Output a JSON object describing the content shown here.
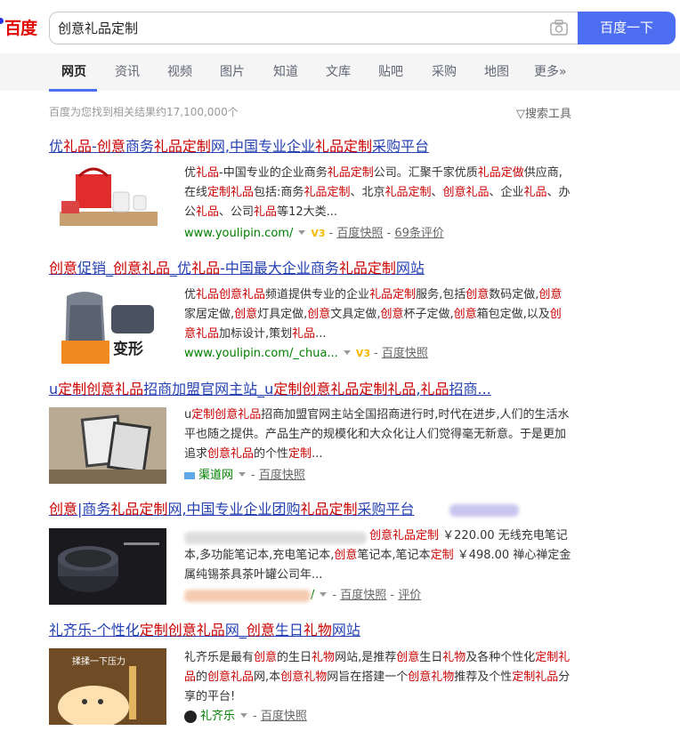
{
  "header": {
    "logo_text": "百度",
    "query": "创意礼品定制",
    "search_button": "百度一下",
    "brand_color": "#4e6ef2"
  },
  "tabs": [
    "网页",
    "资讯",
    "视频",
    "图片",
    "知道",
    "文库",
    "贴吧",
    "采购",
    "地图",
    "更多»"
  ],
  "active_tab": "网页",
  "stats": "百度为您找到相关结果约17,100,000个",
  "tools": "搜索工具",
  "results": [
    {
      "title": "优礼品-创意商务礼品定制网,中国专业企业礼品定制采购平台",
      "abstract": "优礼品-中国专业的企业商务礼品定制公司。汇聚千家优质礼品定做供应商,在线定制礼品包括:商务礼品定制、北京礼品定制、创意礼品、企业礼品、办公礼品、公司礼品等12大类...",
      "url": "www.youlipin.com/",
      "badge": "V3",
      "snapshot": "百度快照",
      "reviews": "69条评价"
    },
    {
      "title": "创意促销_创意礼品_优礼品-中国最大企业商务礼品定制网站",
      "abstract": "优礼品创意礼品频道提供专业的企业礼品定制服务,包括创意数码定做,创意家居定做,创意灯具定做,创意文具定做,创意杯子定做,创意箱包定做,以及创意礼品加标设计,策划礼品...",
      "url": "www.youlipin.com/_chua...",
      "badge": "V3",
      "snapshot": "百度快照",
      "thumb_text": "变形"
    },
    {
      "title": "u定制创意礼品招商加盟官网主站_u定制创意礼品定制礼品,礼品招商...",
      "abstract": "u定制创意礼品招商加盟官网主站全国招商进行时,时代在进步,人们的生活水平也随之提供。产品生产的规模化和大众化让人们觉得毫无新意。于是更加追求创意礼品的个性定制...",
      "url": "渠道网",
      "snapshot": "百度快照"
    },
    {
      "title": "创意|商务礼品定制网,中国专业企业团购礼品定制采购平台",
      "abstract": "创意礼品定制 ￥220.00 无线充电笔记本,多功能笔记本,充电笔记本,创意笔记本,笔记本定制 ￥498.00 禅心禅定金属纯锡茶具茶叶罐公司年...",
      "url": "/",
      "snapshot": "百度快照",
      "reviews": "评价"
    },
    {
      "title": "礼齐乐-个性化定制创意礼品网_创意生日礼物网站",
      "abstract": "礼齐乐是最有创意的生日礼物网站,是推荐创意生日礼物及各种个性化定制礼品的创意礼品网,本创意礼物网旨在搭建一个创意礼物推荐及个性定制礼品分享的平台!",
      "url": "礼齐乐",
      "snapshot": "百度快照",
      "thumb_text": "揉揉一下压力"
    }
  ]
}
